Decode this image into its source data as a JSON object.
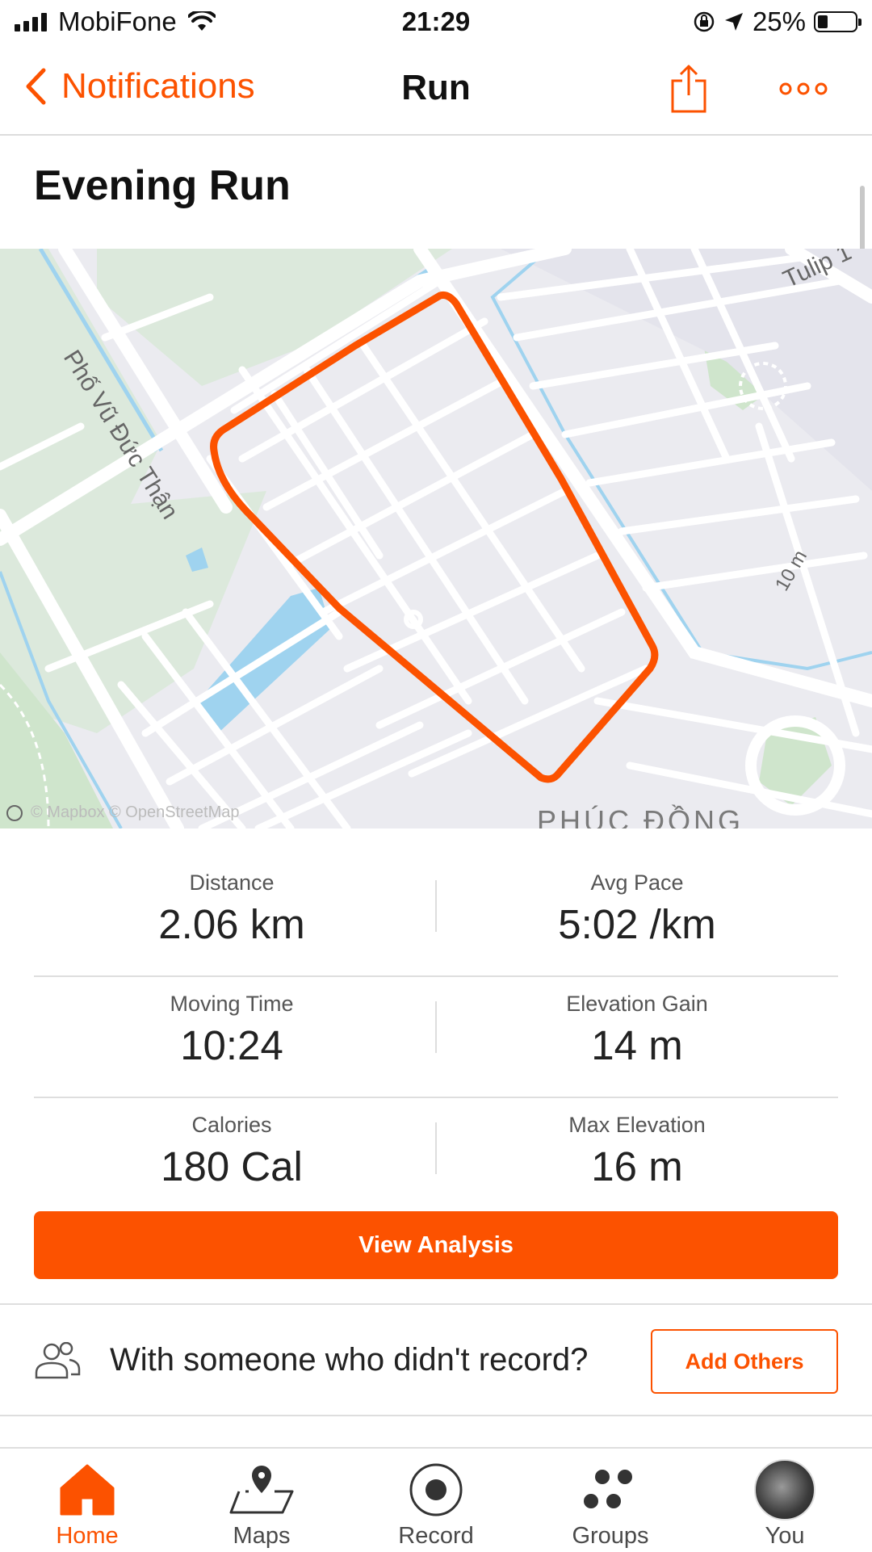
{
  "status_bar": {
    "carrier": "MobiFone",
    "time": "21:29",
    "battery": "25%"
  },
  "nav": {
    "back_label": "Notifications",
    "title": "Run"
  },
  "activity": {
    "title": "Evening Run"
  },
  "map": {
    "road_labels": [
      "Phố Vũ Đức Thận",
      "Tulip 1",
      "10 m"
    ],
    "area_label": "PHÚC ĐỒNG",
    "attribution": "© Mapbox © OpenStreetMap",
    "route_color": "#fc5200"
  },
  "stats": [
    {
      "left": {
        "label": "Distance",
        "value": "2.06 km"
      },
      "right": {
        "label": "Avg Pace",
        "value": "5:02 /km"
      }
    },
    {
      "left": {
        "label": "Moving Time",
        "value": "10:24"
      },
      "right": {
        "label": "Elevation Gain",
        "value": "14 m"
      }
    },
    {
      "left": {
        "label": "Calories",
        "value": "180 Cal"
      },
      "right": {
        "label": "Max Elevation",
        "value": "16 m"
      }
    }
  ],
  "actions": {
    "view_analysis": "View Analysis",
    "others_prompt": "With someone who didn't record?",
    "add_others": "Add Others"
  },
  "tabbar": [
    {
      "label": "Home",
      "icon": "home-icon",
      "active": true
    },
    {
      "label": "Maps",
      "icon": "map-pin-icon",
      "active": false
    },
    {
      "label": "Record",
      "icon": "record-icon",
      "active": false
    },
    {
      "label": "Groups",
      "icon": "groups-icon",
      "active": false
    },
    {
      "label": "You",
      "icon": "avatar",
      "active": false
    }
  ],
  "colors": {
    "accent": "#fc5200",
    "map_bg": "#ebebf0",
    "park": "#d9ead9",
    "water": "#9fd3ef"
  }
}
